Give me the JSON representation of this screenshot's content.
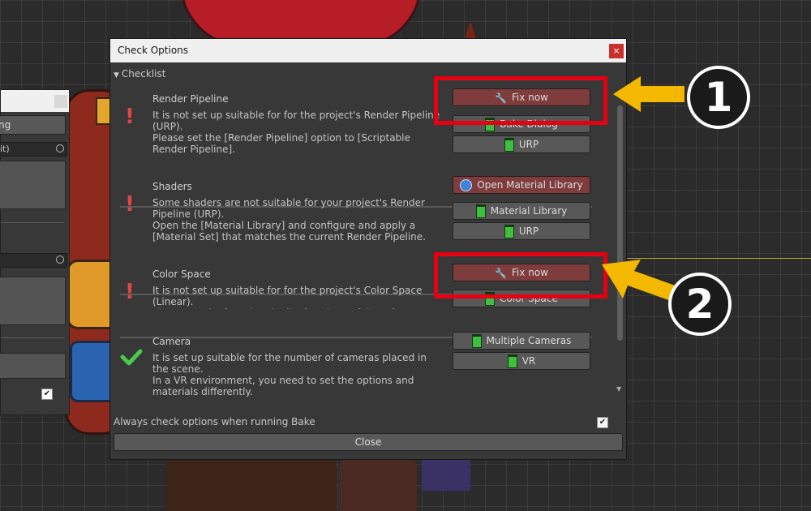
{
  "background_panel": {
    "button_label": "ng",
    "field1_label": "it)",
    "field2_label": ""
  },
  "dialog": {
    "title": "Check Options",
    "close_icon": "×",
    "checklist_label": "Checklist",
    "sections": [
      {
        "title": "Render Pipeline",
        "status": "warning",
        "description": "It is not set up suitable for for the project's Render Pipeline (URP).\nPlease set the [Render Pipeline] option to [Scriptable Render Pipeline].",
        "buttons": [
          {
            "label": "Fix now",
            "icon": "wrench-icon",
            "style": "red"
          },
          {
            "label": "Bake Dialog",
            "icon": "document-icon",
            "style": "normal"
          },
          {
            "label": "URP",
            "icon": "document-icon",
            "style": "normal"
          }
        ]
      },
      {
        "title": "Shaders",
        "status": "warning",
        "description": "Some shaders are not suitable for your project's Render Pipeline (URP).\nOpen the [Material Library] and configure and apply a [Material Set] that matches the current Render Pipeline.",
        "buttons": [
          {
            "label": "Open Material Library",
            "icon": "globe-icon",
            "style": "red"
          },
          {
            "label": "Material Library",
            "icon": "document-icon",
            "style": "normal"
          },
          {
            "label": "URP",
            "icon": "document-icon",
            "style": "normal"
          }
        ]
      },
      {
        "title": "Color Space",
        "status": "warning",
        "description": "It is not set up suitable for for the project's Color Space (Linear).\nPlease set the [Render Pipeline] option to [Linear].",
        "buttons": [
          {
            "label": "Fix now",
            "icon": "wrench-icon",
            "style": "red"
          },
          {
            "label": "Color Space",
            "icon": "document-icon",
            "style": "normal"
          }
        ]
      },
      {
        "title": "Camera",
        "status": "ok",
        "description": "It is set up suitable for the number of cameras placed in the scene.\nIn a VR environment, you need to set the options and materials differently.",
        "buttons": [
          {
            "label": "Multiple Cameras",
            "icon": "document-icon",
            "style": "normal"
          },
          {
            "label": "VR",
            "icon": "document-icon",
            "style": "normal"
          }
        ]
      }
    ],
    "always_check_label": "Always check options when running Bake",
    "always_check_checked": true,
    "close_label": "Close"
  },
  "annotations": {
    "badge_1": "1",
    "badge_2": "2",
    "highlight_color": "#e60012",
    "arrow_color": "#f5b800"
  }
}
